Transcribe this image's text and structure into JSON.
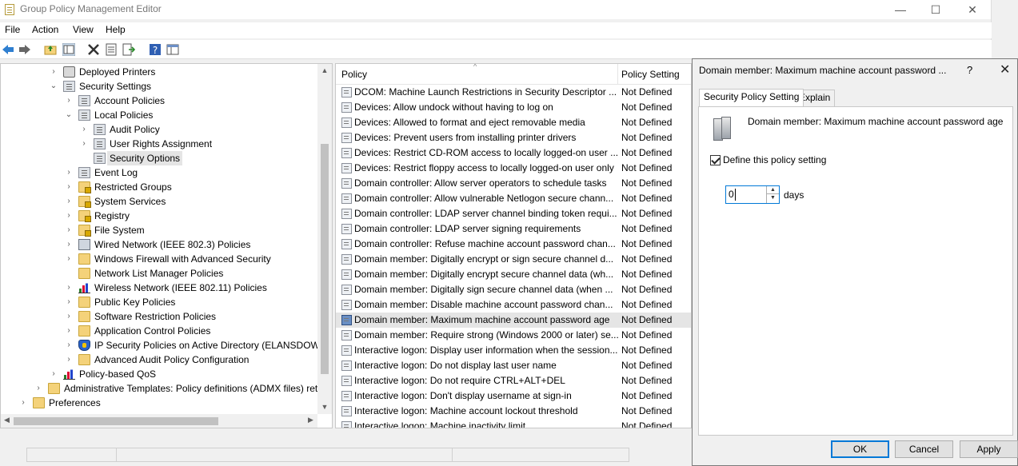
{
  "window": {
    "title": "Group Policy Management Editor",
    "minimize": "—",
    "maximize": "☐",
    "close": "✕"
  },
  "menu": [
    "File",
    "Action",
    "View",
    "Help"
  ],
  "toolbar": [
    "back-icon",
    "forward-icon",
    "up-folder-icon",
    "show-hide-tree-icon",
    "delete-icon",
    "properties-icon",
    "export-icon",
    "help-icon",
    "console-icon"
  ],
  "tree": {
    "items": [
      {
        "label": "Deployed Printers",
        "icon": "printer-icon",
        "chev": "›"
      },
      {
        "label": "Security Settings",
        "icon": "policy-icon",
        "chev": "⌄"
      },
      {
        "label": "Account Policies",
        "icon": "policy-icon",
        "chev": "›"
      },
      {
        "label": "Local Policies",
        "icon": "policy-icon",
        "chev": "⌄"
      },
      {
        "label": "Audit Policy",
        "icon": "policy-icon",
        "chev": "›"
      },
      {
        "label": "User Rights Assignment",
        "icon": "policy-icon",
        "chev": "›"
      },
      {
        "label": "Security Options",
        "icon": "policy-icon",
        "chev": ""
      },
      {
        "label": "Event Log",
        "icon": "policy-icon",
        "chev": "›"
      },
      {
        "label": "Restricted Groups",
        "icon": "folder-lock-icon",
        "chev": "›"
      },
      {
        "label": "System Services",
        "icon": "folder-lock-icon",
        "chev": "›"
      },
      {
        "label": "Registry",
        "icon": "folder-lock-icon",
        "chev": "›"
      },
      {
        "label": "File System",
        "icon": "folder-lock-icon",
        "chev": "›"
      },
      {
        "label": "Wired Network (IEEE 802.3) Policies",
        "icon": "network-icon",
        "chev": "›"
      },
      {
        "label": "Windows Firewall with Advanced Security",
        "icon": "folder-icon",
        "chev": "›"
      },
      {
        "label": "Network List Manager Policies",
        "icon": "folder-icon",
        "chev": ""
      },
      {
        "label": "Wireless Network (IEEE 802.11) Policies",
        "icon": "chart-icon",
        "chev": "›"
      },
      {
        "label": "Public Key Policies",
        "icon": "folder-icon",
        "chev": "›"
      },
      {
        "label": "Software Restriction Policies",
        "icon": "folder-icon",
        "chev": "›"
      },
      {
        "label": "Application Control Policies",
        "icon": "folder-icon",
        "chev": "›"
      },
      {
        "label": "IP Security Policies on Active Directory (ELANSDOWN",
        "icon": "shield-icon",
        "chev": "›"
      },
      {
        "label": "Advanced Audit Policy Configuration",
        "icon": "folder-icon",
        "chev": "›"
      },
      {
        "label": "Policy-based QoS",
        "icon": "chart-icon",
        "chev": "›"
      },
      {
        "label": "Administrative Templates: Policy definitions (ADMX files) ret",
        "icon": "folder-icon",
        "chev": "›"
      },
      {
        "label": "Preferences",
        "icon": "folder-icon",
        "chev": "›"
      }
    ]
  },
  "list": {
    "col_policy": "Policy",
    "col_setting": "Policy Setting",
    "rows": [
      {
        "policy": "DCOM: Machine Launch Restrictions in Security Descriptor ...",
        "setting": "Not Defined"
      },
      {
        "policy": "Devices: Allow undock without having to log on",
        "setting": "Not Defined"
      },
      {
        "policy": "Devices: Allowed to format and eject removable media",
        "setting": "Not Defined"
      },
      {
        "policy": "Devices: Prevent users from installing printer drivers",
        "setting": "Not Defined"
      },
      {
        "policy": "Devices: Restrict CD-ROM access to locally logged-on user ...",
        "setting": "Not Defined"
      },
      {
        "policy": "Devices: Restrict floppy access to locally logged-on user only",
        "setting": "Not Defined"
      },
      {
        "policy": "Domain controller: Allow server operators to schedule tasks",
        "setting": "Not Defined"
      },
      {
        "policy": "Domain controller: Allow vulnerable Netlogon secure chann...",
        "setting": "Not Defined"
      },
      {
        "policy": "Domain controller: LDAP server channel binding token requi...",
        "setting": "Not Defined"
      },
      {
        "policy": "Domain controller: LDAP server signing requirements",
        "setting": "Not Defined"
      },
      {
        "policy": "Domain controller: Refuse machine account password chan...",
        "setting": "Not Defined"
      },
      {
        "policy": "Domain member: Digitally encrypt or sign secure channel d...",
        "setting": "Not Defined"
      },
      {
        "policy": "Domain member: Digitally encrypt secure channel data (wh...",
        "setting": "Not Defined"
      },
      {
        "policy": "Domain member: Digitally sign secure channel data (when ...",
        "setting": "Not Defined"
      },
      {
        "policy": "Domain member: Disable machine account password chan...",
        "setting": "Not Defined"
      },
      {
        "policy": "Domain member: Maximum machine account password age",
        "setting": "Not Defined"
      },
      {
        "policy": "Domain member: Require strong (Windows 2000 or later) se...",
        "setting": "Not Defined"
      },
      {
        "policy": "Interactive logon: Display user information when the session...",
        "setting": "Not Defined"
      },
      {
        "policy": "Interactive logon: Do not display last user name",
        "setting": "Not Defined"
      },
      {
        "policy": "Interactive logon: Do not require CTRL+ALT+DEL",
        "setting": "Not Defined"
      },
      {
        "policy": "Interactive logon: Don't display username at sign-in",
        "setting": "Not Defined"
      },
      {
        "policy": "Interactive logon: Machine account lockout threshold",
        "setting": "Not Defined"
      },
      {
        "policy": "Interactive logon: Machine inactivity limit",
        "setting": "Not Defined"
      }
    ]
  },
  "dialog": {
    "title": "Domain member: Maximum machine account password ...",
    "help": "?",
    "close": "✕",
    "tabs": [
      "Security Policy Setting",
      "Explain"
    ],
    "heading": "Domain member: Maximum machine account password age",
    "checkbox_label": "Define this policy setting",
    "spin_value": "0",
    "unit": "days",
    "ok": "OK",
    "cancel": "Cancel",
    "apply": "Apply"
  }
}
